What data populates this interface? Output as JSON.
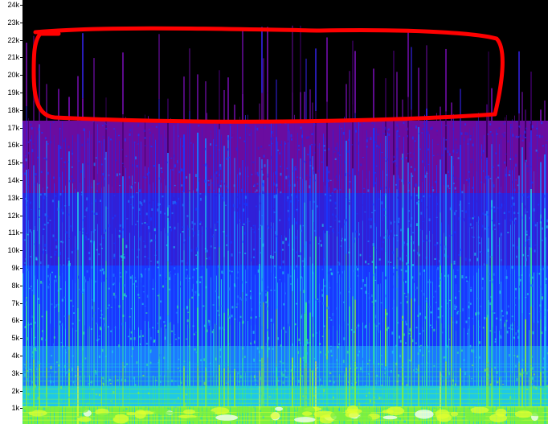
{
  "frequency_axis": {
    "unit_suffix": "k",
    "labels": [
      "24k",
      "23k",
      "22k",
      "21k",
      "20k",
      "19k",
      "18k",
      "17k",
      "16k",
      "15k",
      "14k",
      "13k",
      "12k",
      "11k",
      "10k",
      "9k",
      "8k",
      "7k",
      "6k",
      "5k",
      "4k",
      "3k",
      "2k",
      "1k"
    ],
    "range_khz": [
      0,
      24.5
    ]
  },
  "spectrogram": {
    "colormap": [
      "#000000",
      "#3a0060",
      "#6a0ca0",
      "#3020d8",
      "#1838ff",
      "#1c78ff",
      "#1ec8e8",
      "#30e0a0",
      "#7cf040",
      "#e0ff30",
      "#ffffff"
    ],
    "content_cutoff_khz": 17.5,
    "annotation_color": "#ff0000"
  }
}
